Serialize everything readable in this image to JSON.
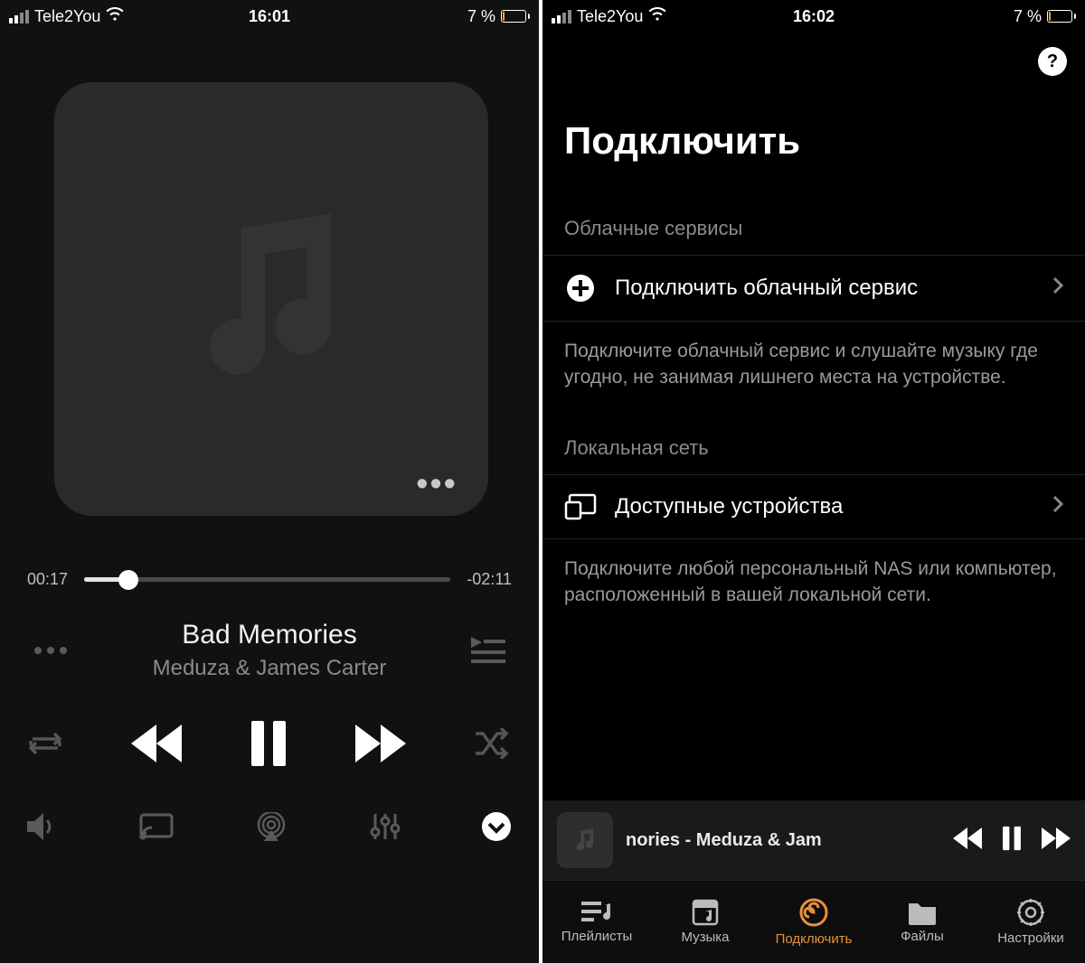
{
  "status": {
    "carrier": "Tele2You",
    "time_left": "16:01",
    "time_right": "16:02",
    "battery_text": "7 %"
  },
  "player": {
    "elapsed": "00:17",
    "remaining": "-02:11",
    "progress_pct": 12,
    "title": "Bad Memories",
    "artist": "Meduza & James Carter"
  },
  "connect": {
    "page_title": "Подключить",
    "help_glyph": "?",
    "cloud_section_label": "Облачные сервисы",
    "cloud_row_label": "Подключить облачный сервис",
    "cloud_desc": "Подключите облачный сервис и слушайте музыку где угодно, не занимая лишнего места на устройстве.",
    "lan_section_label": "Локальная сеть",
    "lan_row_label": "Доступные устройства",
    "lan_desc": "Подключите любой персональный NAS или компьютер, расположенный в вашей локальной сети."
  },
  "mini": {
    "text": "nories - Meduza & Jam"
  },
  "tabs": {
    "playlists": "Плейлисты",
    "music": "Музыка",
    "connect": "Подключить",
    "files": "Файлы",
    "settings": "Настройки"
  }
}
